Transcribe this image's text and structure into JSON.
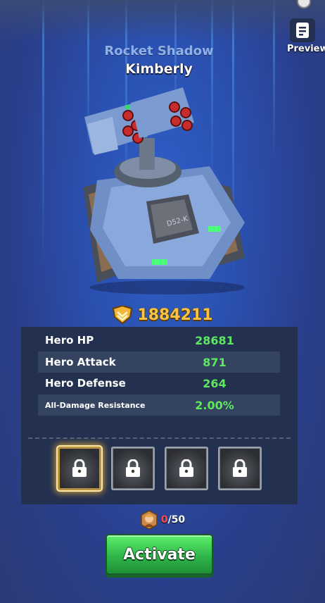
{
  "header": {
    "preview_label": "Preview"
  },
  "hero": {
    "class_name": "Rocket Shadow",
    "name": "Kimberly"
  },
  "power": {
    "value": "1884211",
    "icon": "shield-power-icon"
  },
  "stats": [
    {
      "label": "Hero HP",
      "value": "28681"
    },
    {
      "label": "Hero Attack",
      "value": "871"
    },
    {
      "label": "Hero Defense",
      "value": "264"
    },
    {
      "label": "All-Damage Resistance",
      "value": "2.00%"
    }
  ],
  "skills": [
    {
      "icon": "lock-icon",
      "locked": true,
      "selected": true
    },
    {
      "icon": "lock-icon",
      "locked": true,
      "selected": false
    },
    {
      "icon": "lock-icon",
      "locked": true,
      "selected": false
    },
    {
      "icon": "lock-icon",
      "locked": true,
      "selected": false
    }
  ],
  "cost": {
    "current": "0",
    "required": "/50",
    "icon": "hero-shard-icon"
  },
  "activate_label": "Activate",
  "colors": {
    "stat_value": "#5ee860",
    "power": "#f7c447",
    "button": "#2fb64a"
  }
}
